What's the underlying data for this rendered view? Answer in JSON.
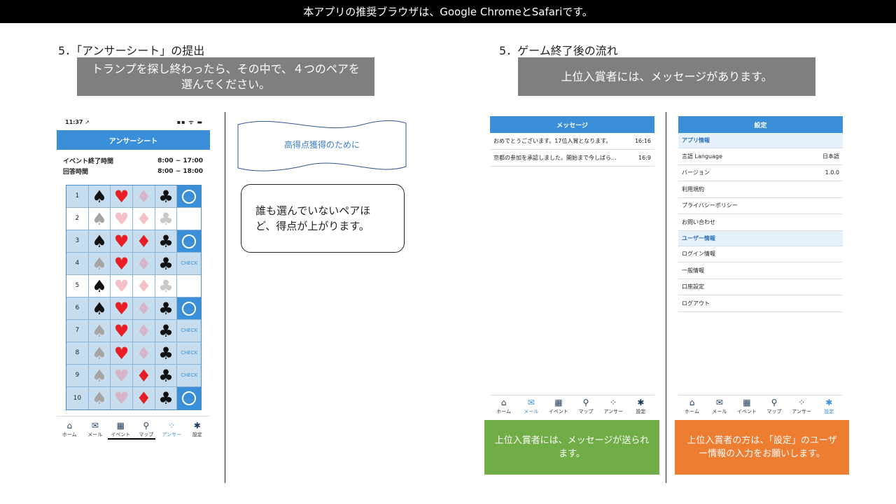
{
  "topbar": {
    "text": "本アプリの推奨ブラウザは、Google ChromeとSafariです。"
  },
  "left": {
    "title": "5．「アンサーシート」の提出",
    "callout": "トランプを探し終わったら、その中で、４つのペアを選んでください。",
    "phone": {
      "time": "11:37 ➚",
      "status_icons": "▪▪ ᯤ ▬",
      "header": "アンサーシート",
      "info": [
        {
          "label": "イベント終了時間",
          "value": "8:00 ~ 17:00"
        },
        {
          "label": "回答時間",
          "value": "8:00 ~ 18:00"
        }
      ],
      "rows": [
        {
          "num": "1",
          "cells": [
            "black",
            "red",
            "lpink",
            "black"
          ],
          "state": "circle",
          "selected": true
        },
        {
          "num": "2",
          "cells": [
            "gray",
            "pink",
            "pink",
            "lgray"
          ],
          "state": "empty",
          "selected": false
        },
        {
          "num": "3",
          "cells": [
            "black",
            "red",
            "red",
            "black"
          ],
          "state": "circle",
          "selected": true
        },
        {
          "num": "4",
          "cells": [
            "gray",
            "red",
            "lpink",
            "black"
          ],
          "state": "check",
          "selected": true
        },
        {
          "num": "5",
          "cells": [
            "black",
            "pink",
            "pink",
            "lgray"
          ],
          "state": "empty",
          "selected": false
        },
        {
          "num": "6",
          "cells": [
            "black",
            "red",
            "lpink",
            "black"
          ],
          "state": "circle",
          "selected": true
        },
        {
          "num": "7",
          "cells": [
            "gray",
            "red",
            "lpink",
            "black"
          ],
          "state": "check",
          "selected": true
        },
        {
          "num": "8",
          "cells": [
            "gray",
            "red",
            "lpink",
            "black"
          ],
          "state": "check",
          "selected": true
        },
        {
          "num": "9",
          "cells": [
            "gray",
            "lpink",
            "red",
            "black"
          ],
          "state": "check",
          "selected": true
        },
        {
          "num": "10",
          "cells": [
            "gray",
            "lpink",
            "red",
            "black"
          ],
          "state": "circle",
          "selected": true
        }
      ],
      "check_label": "CHECK",
      "nav": [
        {
          "icon": "⌂",
          "label": "ホーム"
        },
        {
          "icon": "✉",
          "label": "メール"
        },
        {
          "icon": "▦",
          "label": "イベント"
        },
        {
          "icon": "⚲",
          "label": "マップ"
        },
        {
          "icon": "⁘",
          "label": "アンサー",
          "active": true
        },
        {
          "icon": "✱",
          "label": "設定"
        }
      ]
    },
    "banner": "高得点獲得のために",
    "speech": "誰も選んでいないペアほど、得点が上がります。"
  },
  "right": {
    "title": "5．ゲーム終了後の流れ",
    "callout": "上位入賞者には、メッセージがあります。",
    "messages": {
      "header": "メッセージ",
      "items": [
        {
          "text": "おめでとうございます。17位入賞となります。",
          "time": "16:16"
        },
        {
          "text": "京都の参加を承認しました。開始まで今しばら...",
          "time": "16:9"
        }
      ]
    },
    "settings": {
      "header": "設定",
      "sections": [
        {
          "title": "アプリ情報",
          "rows": [
            {
              "label": "言語 Language",
              "value": "日本語"
            },
            {
              "label": "バージョン",
              "value": "1.0.0"
            },
            {
              "label": "利用規約",
              "value": ""
            },
            {
              "label": "プライバシーポリシー",
              "value": ""
            },
            {
              "label": "お問い合わせ",
              "value": ""
            }
          ]
        },
        {
          "title": "ユーザー情報",
          "rows": [
            {
              "label": "ログイン情報",
              "value": ""
            },
            {
              "label": "一般情報",
              "value": ""
            },
            {
              "label": "口座設定",
              "value": ""
            },
            {
              "label": "ログアウト",
              "value": ""
            }
          ]
        }
      ]
    },
    "nav_msg": [
      {
        "icon": "⌂",
        "label": "ホーム"
      },
      {
        "icon": "✉",
        "label": "メール",
        "active": true
      },
      {
        "icon": "▦",
        "label": "イベント"
      },
      {
        "icon": "⚲",
        "label": "マップ"
      },
      {
        "icon": "⁘",
        "label": "アンサー"
      },
      {
        "icon": "✱",
        "label": "設定"
      }
    ],
    "nav_set": [
      {
        "icon": "⌂",
        "label": "ホーム"
      },
      {
        "icon": "✉",
        "label": "メール"
      },
      {
        "icon": "▦",
        "label": "イベント"
      },
      {
        "icon": "⚲",
        "label": "マップ"
      },
      {
        "icon": "⁘",
        "label": "アンサー"
      },
      {
        "icon": "✱",
        "label": "設定",
        "active": true
      }
    ],
    "green_note": "上位入賞者には、メッセージが送られます。",
    "orange_note": "上位入賞者の方は、「設定」のユーザー情報の入力をお願いします。"
  },
  "colors": {
    "accent": "#3a8fd8",
    "green": "#70ad47",
    "orange": "#ed7d31",
    "gray_callout": "#7f7f7f"
  },
  "suits": [
    "spade",
    "heart",
    "diamond",
    "club"
  ]
}
